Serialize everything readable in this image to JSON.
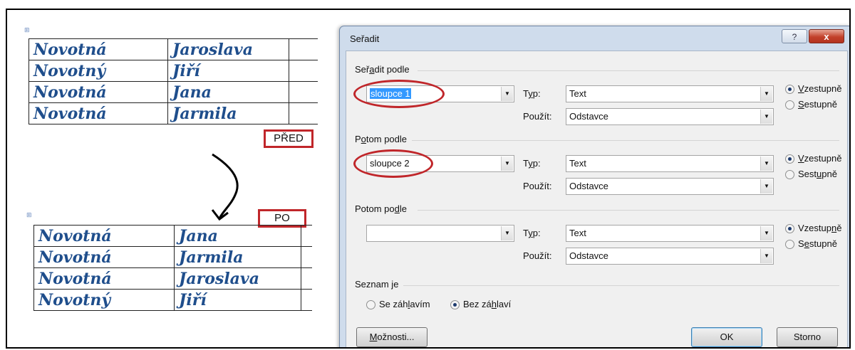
{
  "document": {
    "table_before": [
      [
        "Novotná",
        "Jaroslava"
      ],
      [
        "Novotný",
        "Jiří"
      ],
      [
        "Novotná",
        "Jana"
      ],
      [
        "Novotná",
        "Jarmila"
      ]
    ],
    "table_after": [
      [
        "Novotná",
        "Jana"
      ],
      [
        "Novotná",
        "Jarmila"
      ],
      [
        "Novotná",
        "Jaroslava"
      ],
      [
        "Novotný",
        "Jiří"
      ]
    ],
    "label_before": "PŘED",
    "label_after": "PO"
  },
  "dialog": {
    "title": "Seřadit",
    "help_label": "?",
    "close_label": "x",
    "sections": [
      {
        "pre": "Seř",
        "ul": "a",
        "post": "dit podle",
        "column": "sloupce 1",
        "column_selected": true,
        "type_value": "Text",
        "use_value": "Odstavce",
        "asc": {
          "pre": "",
          "ul": "V",
          "post": "zestupně"
        },
        "desc": {
          "pre": "",
          "ul": "S",
          "post": "estupně"
        },
        "order": "asc",
        "circled": true
      },
      {
        "pre": "P",
        "ul": "o",
        "post": "tom podle",
        "column": "sloupce 2",
        "column_selected": false,
        "type_value": "Text",
        "use_value": "Odstavce",
        "asc": {
          "pre": "",
          "ul": "V",
          "post": "zestupně"
        },
        "desc": {
          "pre": "Sest",
          "ul": "u",
          "post": "pně"
        },
        "order": "asc",
        "circled": true
      },
      {
        "pre": "Potom po",
        "ul": "d",
        "post": "le",
        "column": "",
        "column_selected": false,
        "type_value": "Text",
        "use_value": "Odstavce",
        "asc": {
          "pre": "Vzestup",
          "ul": "n",
          "post": "ě"
        },
        "desc": {
          "pre": "S",
          "ul": "e",
          "post": "stupně"
        },
        "order": "asc",
        "circled": false
      }
    ],
    "type_label": {
      "pre": "T",
      "ul": "y",
      "post": "p:"
    },
    "use_label": "Použít:",
    "list_section": "Seznam je",
    "header_option": {
      "pre": "Se záh",
      "ul": "l",
      "post": "avím"
    },
    "no_header_option": {
      "pre": "Bez zá",
      "ul": "h",
      "post": "laví"
    },
    "list_selected": "no_header",
    "options_button": {
      "pre": "",
      "ul": "M",
      "post": "ožnosti..."
    },
    "ok_button": "OK",
    "cancel_button": "Storno"
  },
  "colors": {
    "accent": "#c0262a",
    "doc_text": "#1f4e8c",
    "selection": "#3399ff"
  }
}
